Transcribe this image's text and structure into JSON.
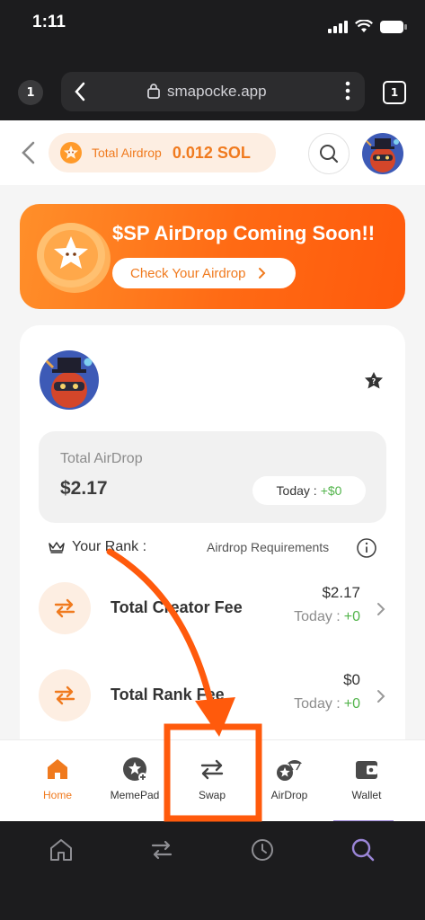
{
  "status_bar": {
    "time": "1:11"
  },
  "browser": {
    "tab_badge": "1",
    "url": "smapocke.app",
    "tabs_count": "1"
  },
  "header": {
    "airdrop_label": "Total Airdrop",
    "airdrop_value": "0.012 SOL"
  },
  "banner": {
    "title": "$SP AirDrop Coming Soon!!",
    "button": "Check Your Airdrop"
  },
  "summary": {
    "label": "Total AirDrop",
    "value": "$2.17",
    "today_label": "Today :",
    "today_value": "+$0"
  },
  "rank": {
    "label": "Your Rank :",
    "requirements": "Airdrop Requirements"
  },
  "fees": [
    {
      "title": "Total Creator Fee",
      "value": "$2.17",
      "today_label": "Today :",
      "today_value": "+0"
    },
    {
      "title": "Total Rank Fee",
      "value": "$0",
      "today_label": "Today :",
      "today_value": "+0"
    }
  ],
  "nav": [
    {
      "label": "Home",
      "icon": "home-icon",
      "active": true
    },
    {
      "label": "MemePad",
      "icon": "memepad-icon"
    },
    {
      "label": "Swap",
      "icon": "swap-icon"
    },
    {
      "label": "AirDrop",
      "icon": "airdrop-icon"
    },
    {
      "label": "Wallet",
      "icon": "wallet-icon"
    }
  ],
  "colors": {
    "accent": "#f07a1e",
    "banner": "#ff6a14",
    "positive": "#52b44b",
    "highlight": "#ff5a0c"
  }
}
